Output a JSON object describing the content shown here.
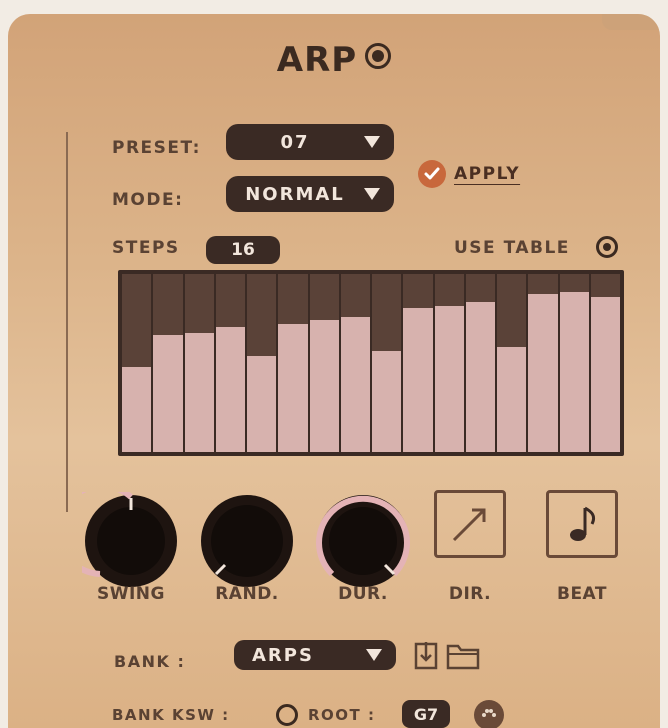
{
  "title": "ARP",
  "preset": {
    "label": "PRESET:",
    "value": "07"
  },
  "mode": {
    "label": "MODE:",
    "value": "NORMAL"
  },
  "apply": {
    "label": "APPLY"
  },
  "steps": {
    "label": "STEPS",
    "value": "16"
  },
  "use_table": {
    "label": "USE TABLE"
  },
  "table": {
    "levels": [
      0.48,
      0.66,
      0.67,
      0.7,
      0.54,
      0.72,
      0.74,
      0.76,
      0.57,
      0.81,
      0.82,
      0.84,
      0.59,
      0.89,
      0.9,
      0.87
    ]
  },
  "controls": {
    "swing": {
      "label": "SWING"
    },
    "rand": {
      "label": "RAND."
    },
    "dur": {
      "label": "DUR."
    },
    "dir": {
      "label": "DIR."
    },
    "beat": {
      "label": "BEAT"
    }
  },
  "bank": {
    "label": "BANK :",
    "value": "ARPS"
  },
  "bank_ksw": {
    "label": "BANK KSW :"
  },
  "root": {
    "label": "ROOT :",
    "value": "G7"
  },
  "colors": {
    "accent": "#c8683c",
    "dark": "#3a2a24",
    "bar": "#d7b2ae",
    "knob_ring": "#e4b3b6"
  }
}
